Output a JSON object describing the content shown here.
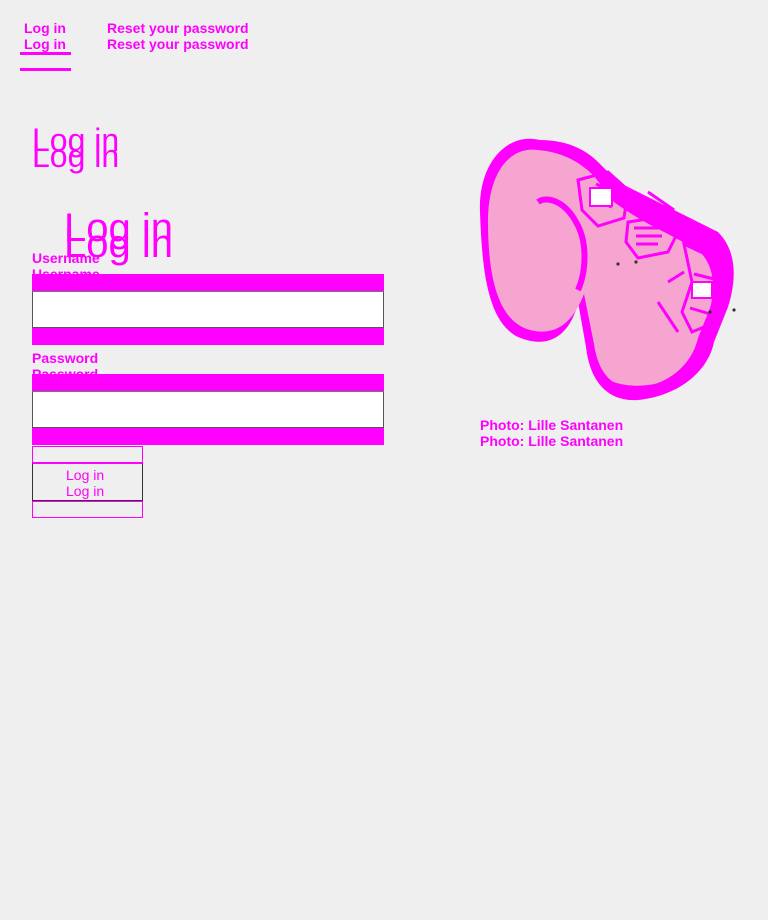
{
  "tabs": {
    "login_label": "Log in",
    "reset_label": "Reset your password"
  },
  "page": {
    "title": "Log in"
  },
  "form": {
    "title": "Log in",
    "username_label": "Username",
    "username_value": "",
    "password_label": "Password",
    "password_value": "",
    "submit_label": "Log in"
  },
  "illustration": {
    "caption": "Photo: Lille Santanen",
    "icon": "illustration-image"
  },
  "colors": {
    "background": "#efefef",
    "accent": "#ff00ff",
    "illustration_fill": "#f5a5cf"
  }
}
